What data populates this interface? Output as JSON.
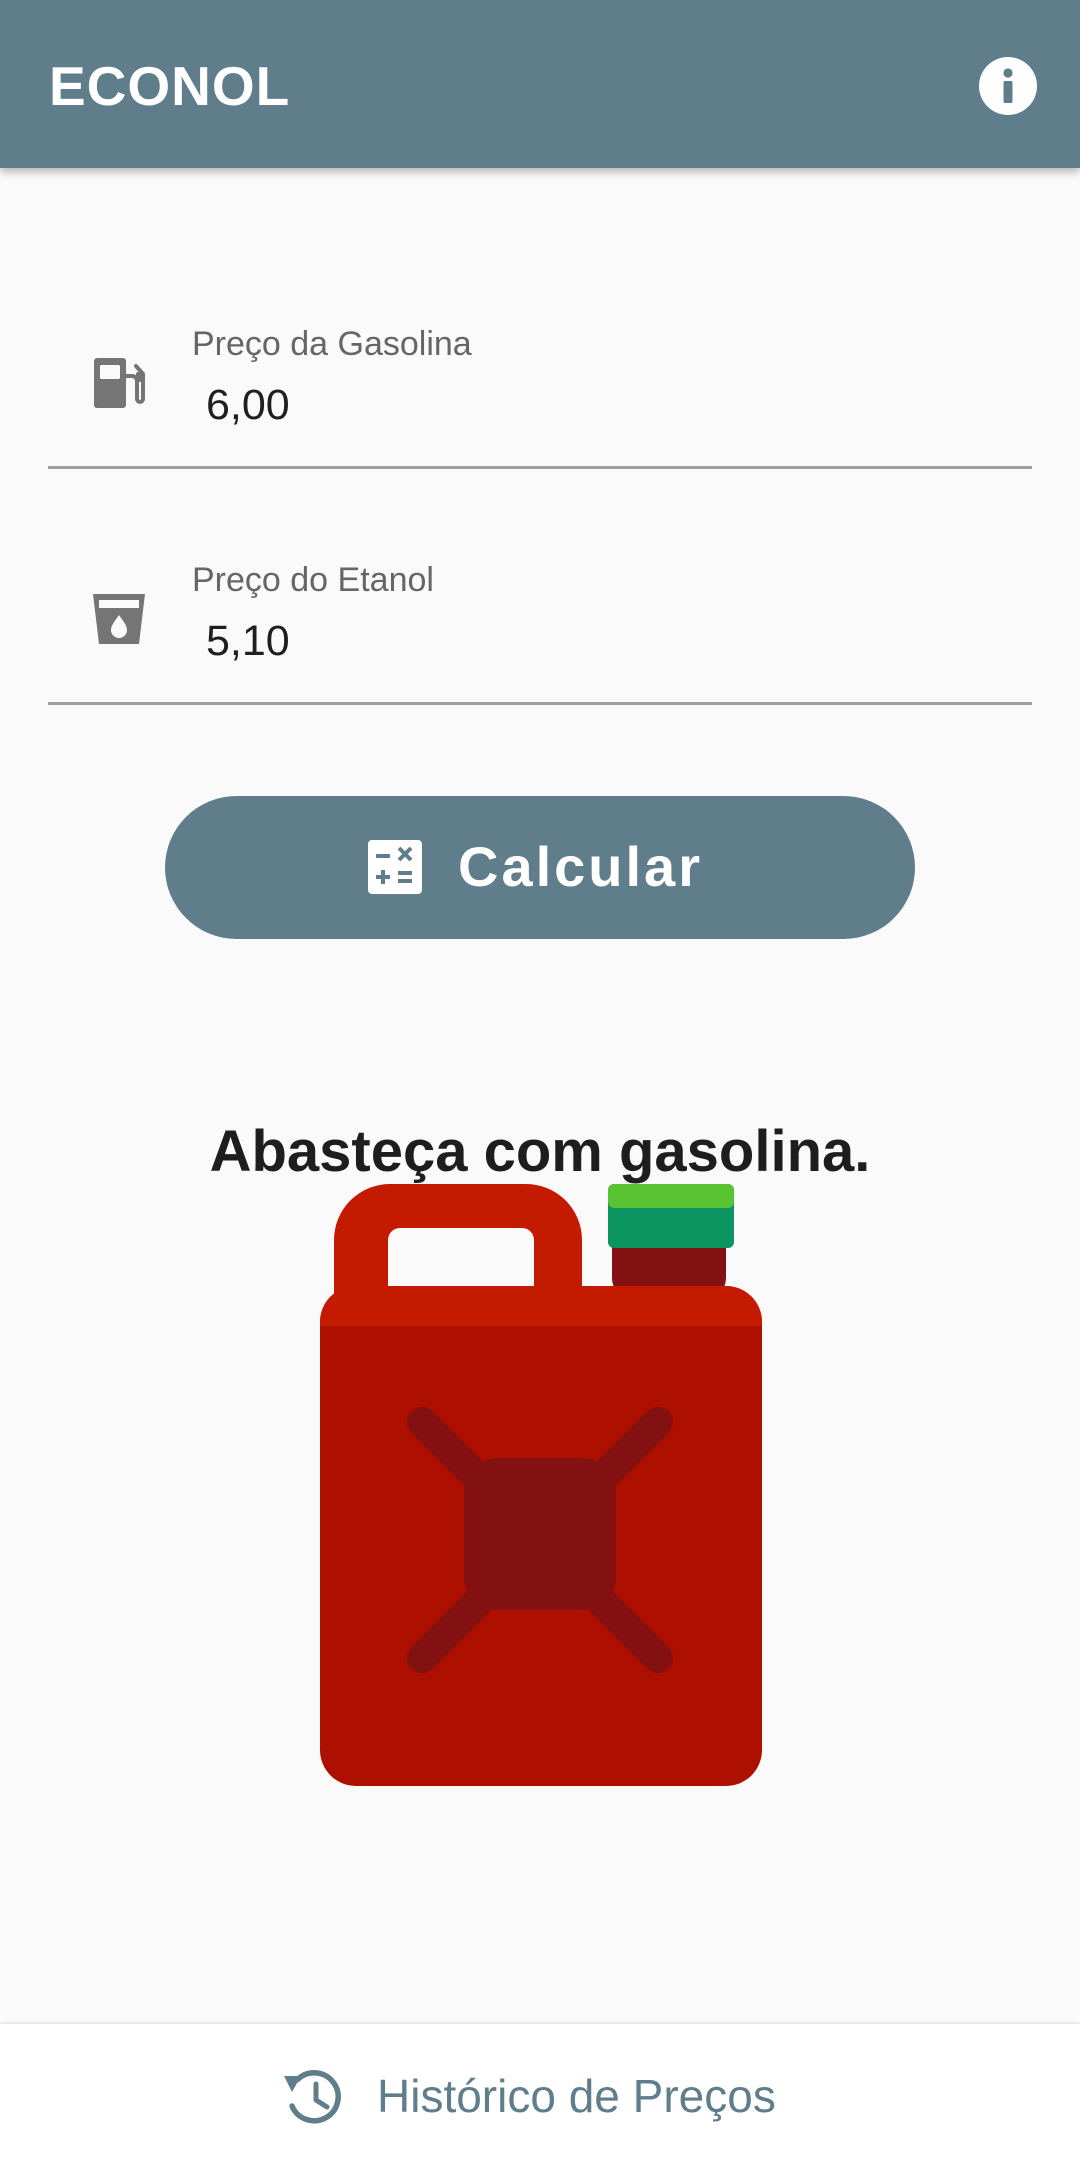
{
  "app": {
    "title": "ECONOL",
    "colors": {
      "primary": "#607d8b",
      "background": "#fafafa",
      "fuel_can_red": "#ad0f00",
      "cap_green": "#0b9360"
    }
  },
  "toolbar": {
    "info_icon": "info-icon"
  },
  "form": {
    "gasoline": {
      "label": "Preço da Gasolina",
      "value": "6,00",
      "icon": "gas-pump-icon"
    },
    "ethanol": {
      "label": "Preço do Etanol",
      "value": "5,10",
      "icon": "drink-cup-icon"
    }
  },
  "calculate_button": {
    "label": "Calcular",
    "icon": "calculator-icon"
  },
  "result": {
    "message": "Abasteça com gasolina.",
    "image": "red-fuel-can-illustration"
  },
  "bottom": {
    "history_label": "Histórico de Preços",
    "history_icon": "history-icon"
  }
}
